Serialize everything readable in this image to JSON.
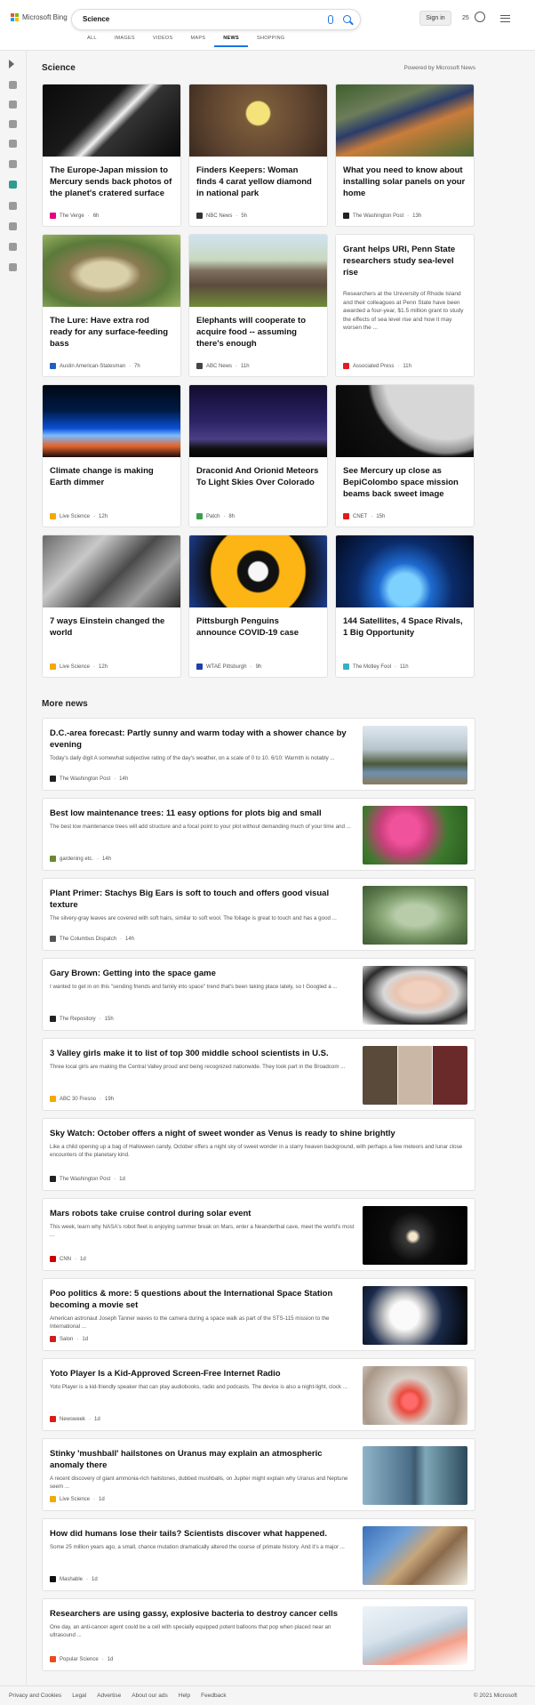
{
  "header": {
    "logo_text": "Microsoft Bing",
    "search_value": "Science",
    "signin_label": "Sign in",
    "rewards_count": "25",
    "tabs": [
      {
        "label": "ALL"
      },
      {
        "label": "IMAGES"
      },
      {
        "label": "VIDEOS"
      },
      {
        "label": "MAPS"
      },
      {
        "label": "NEWS",
        "active": true
      },
      {
        "label": "SHOPPING"
      }
    ]
  },
  "sidebar": {
    "items": [
      {
        "icon": "expand-icon"
      },
      {
        "icon": "home-icon"
      },
      {
        "icon": "tools-icon"
      },
      {
        "icon": "flag-icon"
      },
      {
        "icon": "location-icon"
      },
      {
        "icon": "globe-icon"
      },
      {
        "icon": "science-icon",
        "active": true
      },
      {
        "icon": "rocket-icon"
      },
      {
        "icon": "film-icon"
      },
      {
        "icon": "bank-icon"
      },
      {
        "icon": "card-icon"
      }
    ]
  },
  "section": {
    "title": "Science",
    "powered_by": "Powered by Microsoft News"
  },
  "cards": [
    {
      "title": "The Europe-Japan mission to Mercury sends back photos of the planet's cratered surface",
      "source": "The Verge",
      "time": "6h",
      "image": "mercury-probe",
      "source_color": "#e6007e"
    },
    {
      "title": "Finders Keepers: Woman finds 4 carat yellow diamond in national park",
      "source": "NBC News",
      "time": "5h",
      "image": "yellow-diamond",
      "source_color": "#333333"
    },
    {
      "title": "What you need to know about installing solar panels on your home",
      "source": "The Washington Post",
      "time": "13h",
      "image": "solar-roof",
      "source_color": "#222222"
    },
    {
      "title": "The Lure: Have extra rod ready for any surface-feeding bass",
      "source": "Austin American-Statesman",
      "time": "7h",
      "image": "bass-fish",
      "source_color": "#1f5fbf"
    },
    {
      "title": "Elephants will cooperate to acquire food -- assuming there's enough",
      "source": "ABC News",
      "time": "11h",
      "image": "elephants",
      "source_color": "#444444"
    },
    {
      "title": "Grant helps URI, Penn State researchers study sea-level rise",
      "source": "Associated Press",
      "time": "11h",
      "snippet": "Researchers at the University of Rhode Island and their colleagues at Penn State have been awarded a four-year, $1.5 million grant to study the effects of sea level rise and how it may worsen the ...",
      "text_only": true,
      "source_color": "#e31b23"
    },
    {
      "title": "Climate change is making Earth dimmer",
      "source": "Live Science",
      "time": "12h",
      "image": "earth-horizon",
      "source_color": "#f2a900"
    },
    {
      "title": "Draconid And Orionid Meteors To Light Skies Over Colorado",
      "source": "Patch",
      "time": "8h",
      "image": "meteor-sky",
      "source_color": "#3aa048"
    },
    {
      "title": "See Mercury up close as BepiColombo space mission beams back sweet image",
      "source": "CNET",
      "time": "15h",
      "image": "mercury-closeup",
      "source_color": "#e21b1b"
    },
    {
      "title": "7 ways Einstein changed the world",
      "source": "Live Science",
      "time": "12h",
      "image": "einstein",
      "source_color": "#f2a900"
    },
    {
      "title": "Pittsburgh Penguins announce COVID-19 case",
      "source": "WTAE Pittsburgh",
      "time": "9h",
      "image": "penguins-logo",
      "source_color": "#1e40a8"
    },
    {
      "title": "144 Satellites, 4 Space Rivals, 1 Big Opportunity",
      "source": "The Motley Fool",
      "time": "11h",
      "image": "earth-network",
      "source_color": "#36b0c9"
    }
  ],
  "more_news": {
    "title": "More news",
    "items": [
      {
        "title": "D.C.-area forecast: Partly sunny and warm today with a shower chance by evening",
        "snippet": "Today's daily digit A somewhat subjective rating of the day's weather, on a scale of 0 to 10. 6/10: Warmth is notably ...",
        "source": "The Washington Post",
        "time": "14h",
        "image": "dc-tree",
        "source_color": "#222222"
      },
      {
        "title": "Best low maintenance trees: 11 easy options for plots big and small",
        "snippet": "The best low maintenance trees will add structure and a focal point to your plot without demanding much of your time and ...",
        "source": "gardening etc.",
        "time": "14h",
        "image": "pink-blossom",
        "source_color": "#6a8a2e"
      },
      {
        "title": "Plant Primer: Stachys Big Ears is soft to touch and offers good visual texture",
        "snippet": "The silvery-gray leaves are covered with soft hairs, similar to soft wool. The foliage is great to touch and has a good ...",
        "source": "The Columbus Dispatch",
        "time": "14h",
        "image": "lambs-ear",
        "source_color": "#555555"
      },
      {
        "title": "Gary Brown: Getting into the space game",
        "snippet": "I wanted to get in on this \"sending friends and family into space\" trend that's been taking place lately, so I Googled a ...",
        "source": "The Repository",
        "time": "15h",
        "image": "portrait",
        "source_color": "#222222"
      },
      {
        "title": "3 Valley girls make it to list of top 300 middle school scientists in U.S.",
        "snippet": "Three local girls are making the Central Valley proud and being recognized nationwide. They took part in the Broadcom ...",
        "source": "ABC 30 Fresno",
        "time": "19h",
        "image": "three-girls",
        "source_color": "#f2a900"
      },
      {
        "title": "Sky Watch: October offers a night of sweet wonder as Venus is ready to shine brightly",
        "snippet": "Like a child opening up a bag of Halloween candy, October offers a night sky of sweet wonder in a starry heaven background, with perhaps a few meteors and lunar close encounters of the planetary kind.",
        "source": "The Washington Post",
        "time": "1d",
        "wide": true,
        "source_color": "#222222"
      },
      {
        "title": "Mars robots take cruise control during solar event",
        "snippet": "This week, learn why NASA's robot fleet is enjoying summer break on Mars, enter a Neanderthal cave, meet the world's most ...",
        "source": "CNN",
        "time": "1d",
        "image": "sun-space",
        "source_color": "#cc0000"
      },
      {
        "title": "Poo politics & more: 5 questions about the International Space Station becoming a movie set",
        "snippet": "American astronaut Joseph Tanner waves to the camera during a space walk as part of the STS-115 mission to the International ...",
        "source": "Salon",
        "time": "1d",
        "image": "astronaut",
        "source_color": "#cc1f1f"
      },
      {
        "title": "Yoto Player Is a Kid-Approved Screen-Free Internet Radio",
        "snippet": "Yoto Player is a kid-friendly speaker that can play audiobooks, radio and podcasts. The device is also a night-light, clock ...",
        "source": "Newsweek",
        "time": "1d",
        "image": "yoto-player",
        "source_color": "#d91e18"
      },
      {
        "title": "Stinky 'mushball' hailstones on Uranus may explain an atmospheric anomaly there",
        "snippet": "A recent discovery of giant ammonia-rich hailstones, dubbed mushballs, on Jupiter might explain why Uranus and Neptune seem ...",
        "source": "Live Science",
        "time": "1d",
        "image": "uranus-storm",
        "source_color": "#f2a900"
      },
      {
        "title": "How did humans lose their tails? Scientists discover what happened.",
        "snippet": "Some 25 million years ago, a small, chance mutation dramatically altered the course of primate history. And it's a major ...",
        "source": "Mashable",
        "time": "1d",
        "image": "monkey",
        "source_color": "#111111"
      },
      {
        "title": "Researchers are using gassy, explosive bacteria to destroy cancer cells",
        "snippet": "One day, an anti-cancer agent could be a cell with specially equipped potent balloons that pop when placed near an ultrasound ...",
        "source": "Popular Science",
        "time": "1d",
        "image": "lab-tubes",
        "source_color": "#e84c1e"
      }
    ]
  },
  "footer": {
    "links": [
      "Privacy and Cookies",
      "Legal",
      "Advertise",
      "About our ads",
      "Help",
      "Feedback"
    ],
    "copyright": "© 2021 Microsoft"
  },
  "colors": {
    "accent": "#1a73e8",
    "bing_red": "#f25022",
    "bing_green": "#7fba00",
    "bing_blue": "#00a4ef",
    "bing_yellow": "#ffb900"
  }
}
